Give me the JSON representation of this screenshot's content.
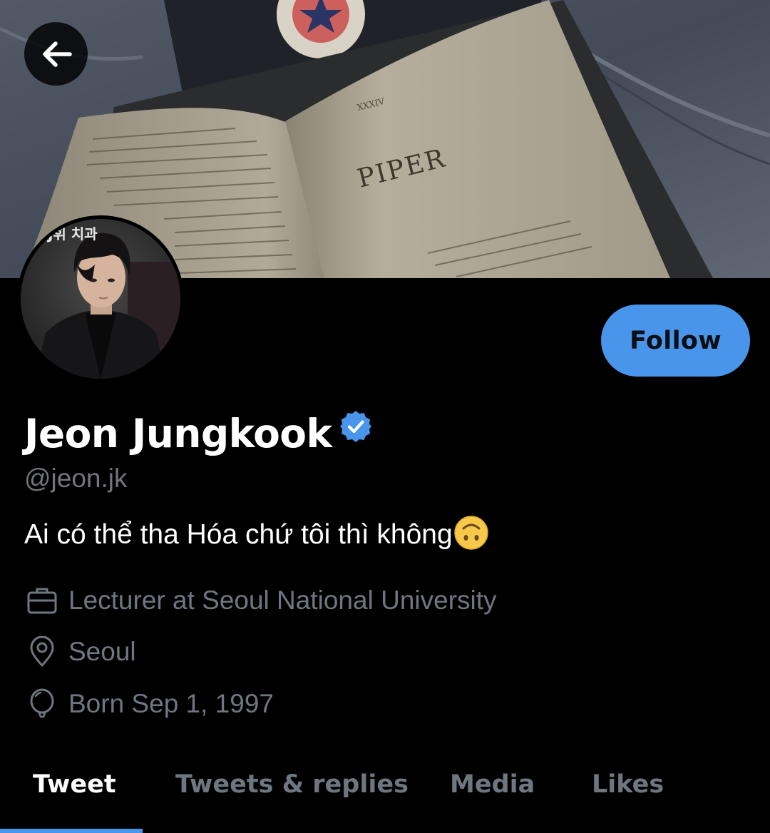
{
  "profile": {
    "display_name": "Jeon Jungkook",
    "handle": "@jeon.jk",
    "bio": "Ai có thể tha Hóa chứ tôi thì không",
    "bio_emoji": "upside-down-face-icon",
    "verified_icon": "verified-badge-icon",
    "follow_label": "Follow"
  },
  "banner": {
    "book_page_heading": "PIPER",
    "book_page_number": "XXXIV"
  },
  "info": {
    "work": "Lecturer at Seoul National University",
    "location": "Seoul",
    "birthday": "Born Sep 1, 1997"
  },
  "tabs": [
    {
      "label": "Tweet",
      "active": true
    },
    {
      "label": "Tweets & replies",
      "active": false
    },
    {
      "label": "Media",
      "active": false
    },
    {
      "label": "Likes",
      "active": false
    }
  ],
  "colors": {
    "accent": "#4a95ec",
    "background": "#000000",
    "muted_text": "#6e7781"
  }
}
